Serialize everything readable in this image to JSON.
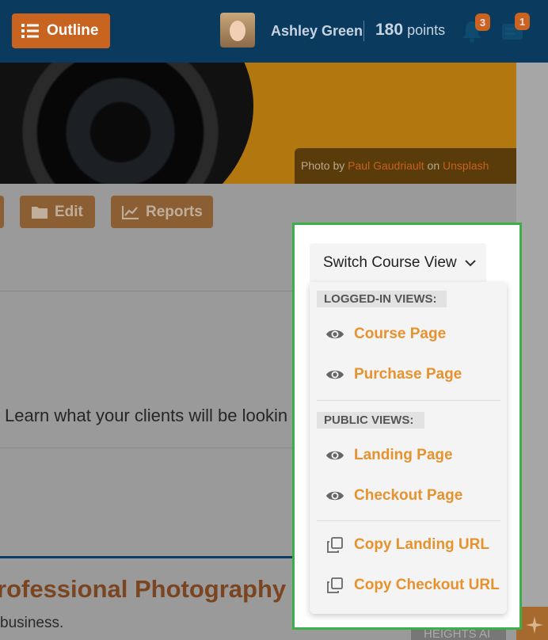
{
  "topbar": {
    "outline_label": "Outline",
    "user_name": "Ashley Green",
    "points_value": "180",
    "points_unit": "points",
    "notifications_count": "3",
    "messages_count": "1"
  },
  "hero": {
    "credit_prefix": "Photo by ",
    "credit_author": "Paul Gaudriault",
    "credit_mid": " on ",
    "credit_site": "Unsplash"
  },
  "actions": {
    "edit_label": "Edit",
    "reports_label": "Reports"
  },
  "content": {
    "learn_text": "Learn what your clients will be lookin",
    "course_title": "rofessional Photography",
    "business_text": "business.",
    "heights_text": "HEIGHTS AI"
  },
  "switch_view": {
    "button_label": "Switch Course View",
    "logged_in_heading": "LOGGED-IN VIEWS:",
    "public_heading": "PUBLIC VIEWS:",
    "items": [
      {
        "label": "Course Page",
        "icon": "eye-icon"
      },
      {
        "label": "Purchase Page",
        "icon": "eye-icon"
      },
      {
        "label": "Landing Page",
        "icon": "eye-icon"
      },
      {
        "label": "Checkout Page",
        "icon": "eye-icon"
      },
      {
        "label": "Copy Landing URL",
        "icon": "copy-icon"
      },
      {
        "label": "Copy Checkout URL",
        "icon": "copy-icon"
      }
    ]
  },
  "colors": {
    "topbar": "#0a3a5e",
    "accent_orange": "#c8641f",
    "menu_link": "#e6922f",
    "highlight_border": "#3bb04a"
  }
}
